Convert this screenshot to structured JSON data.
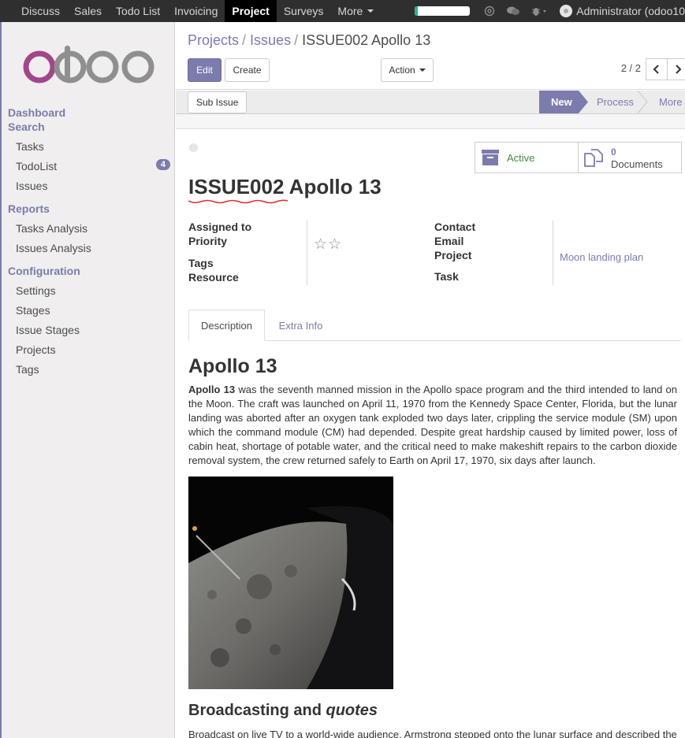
{
  "topbar": {
    "menu": [
      "Discuss",
      "Sales",
      "Todo List",
      "Invoicing",
      "Project",
      "Surveys",
      "More"
    ],
    "active": "Project",
    "user": "Administrator (odoo10",
    "progress": 0.05
  },
  "sidebar": {
    "logo_text": "odoo",
    "dashboard": "Dashboard",
    "search": "Search",
    "search_items": [
      "Tasks",
      "TodoList",
      "Issues"
    ],
    "todolist_badge": "4",
    "reports": "Reports",
    "report_items": [
      "Tasks Analysis",
      "Issues Analysis"
    ],
    "configuration": "Configuration",
    "config_items": [
      "Settings",
      "Stages",
      "Issue Stages",
      "Projects",
      "Tags"
    ]
  },
  "breadcrumb": [
    "Projects",
    "Issues",
    "ISSUE002 Apollo 13"
  ],
  "buttons": {
    "edit": "Edit",
    "create": "Create",
    "action": "Action",
    "sub_issue": "Sub Issue"
  },
  "pager": "2 / 2",
  "stages": [
    "New",
    "Process",
    "More"
  ],
  "smart_buttons": {
    "active": "Active",
    "documents_count": "0",
    "documents": "Documents"
  },
  "record": {
    "code": "ISSUE002",
    "name": "Apollo 13"
  },
  "fields": {
    "assigned_to": "Assigned to",
    "priority": "Priority",
    "tags": "Tags",
    "resource": "Resource",
    "contact": "Contact",
    "email": "Email",
    "project": "Project",
    "project_value": "Moon landing plan",
    "task": "Task",
    "stars": "☆☆"
  },
  "tabs": [
    "Description",
    "Extra Info"
  ],
  "description": {
    "heading": "Apollo 13",
    "lead_bold": "Apollo 13",
    "body": " was the seventh manned mission in the Apollo space program and the third intended to land on the Moon. The craft was launched on April 11, 1970 from the Kennedy Space Center, Florida, but the lunar landing was aborted after an oxygen tank exploded two days later, crippling the service module (SM) upon which the command module (CM) had depended. Despite great hardship caused by limited power, loss of cabin heat, shortage of potable water, and the critical need to make makeshift repairs to the carbon dioxide removal system, the crew returned safely to Earth on April 17, 1970, six days after launch.",
    "h2_plain": "Broadcasting and ",
    "h2_italic": "quotes",
    "body2": "Broadcast on live TV to a world-wide audience, Armstrong stepped onto the lunar surface and described the"
  }
}
